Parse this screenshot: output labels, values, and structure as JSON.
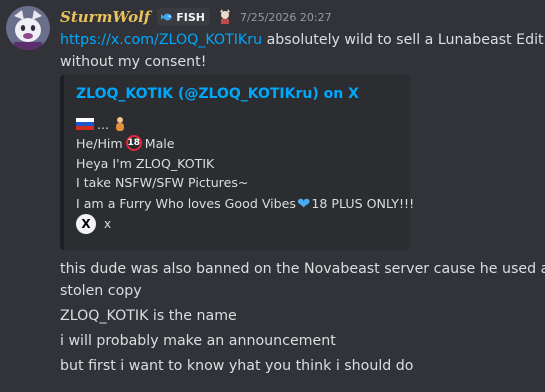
{
  "message": {
    "username": "SturmWolf",
    "tag_label": "FISH",
    "timestamp": "7/25/2026 20:27",
    "text_link": "https://x.com/ZLOQ_KOTIKru",
    "text_line1_rest": " absolutely wild to sell a Lunabeast Edit",
    "text_line2": "without my consent!"
  },
  "embed": {
    "title": "ZLOQ_KOTIK (@ZLOQ_KOTIKru) on X",
    "line1_dots": "...",
    "line2_prefix": "He/Him",
    "line2_badge": "18",
    "line2_suffix": "Male",
    "line3": "Heya I'm ZLOQ_KOTIK",
    "line4": "I take NSFW/SFW Pictures~",
    "line5_prefix": "I am a Furry Who loves Good Vibes",
    "line5_suffix": " 18 PLUS ONLY!!!",
    "footer_text": "x",
    "x_logo_glyph": "X"
  },
  "followups": [
    "this dude was also banned on the Novabeast server cause he used a",
    "stolen copy",
    "ZLOQ_KOTIK is the name",
    "i will probably make an announcement",
    "but first i want to know yhat you think i should do"
  ],
  "colors": {
    "background": "#313338",
    "username": "#e8c25a",
    "link": "#00a8fc",
    "embed_bg": "#2b2d31"
  },
  "icons": {
    "avatar": "avatar-wolf",
    "tag": "fish-icon",
    "role": "role-badge-icon",
    "flag": "russia-flag-icon",
    "heart": "blue-heart-icon"
  }
}
